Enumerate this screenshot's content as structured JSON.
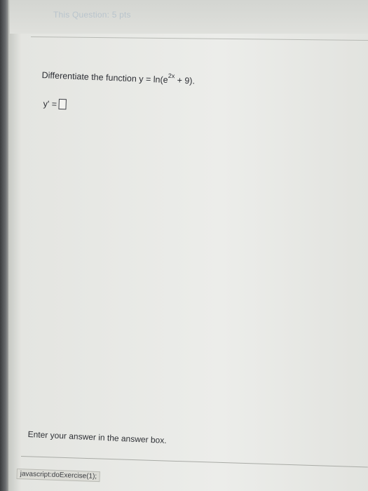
{
  "header": {
    "question_label": "This Question: 5 pts"
  },
  "question": {
    "prompt_prefix": "Differentiate the function y = ln",
    "prompt_base": "(e",
    "prompt_exponent": "2x",
    "prompt_suffix": "+ 9)."
  },
  "answer": {
    "label": "y' =",
    "value": ""
  },
  "footer": {
    "instruction": "Enter your answer in the answer box."
  },
  "status_bar": {
    "text": "javascript:doExercise(1);"
  }
}
